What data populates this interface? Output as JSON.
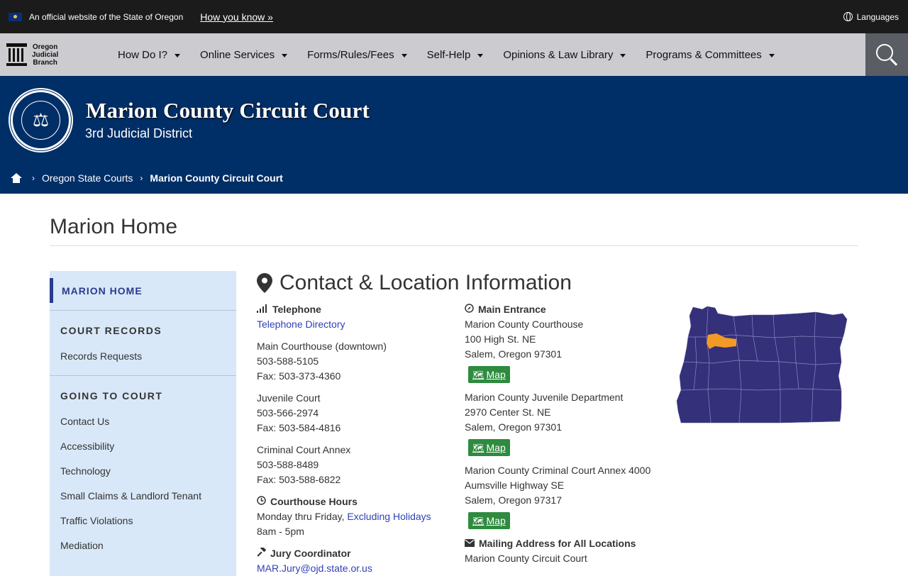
{
  "gov_banner": {
    "official_text": "An official website of the State of Oregon",
    "how_you_know": "How you know »",
    "languages": "Languages"
  },
  "brand": {
    "logo_lines": [
      "Oregon",
      "Judicial",
      "Branch"
    ]
  },
  "nav": {
    "items": [
      {
        "label": "How Do I?"
      },
      {
        "label": "Online Services"
      },
      {
        "label": "Forms/Rules/Fees"
      },
      {
        "label": "Self-Help"
      },
      {
        "label": "Opinions & Law Library"
      },
      {
        "label": "Programs & Committees"
      }
    ]
  },
  "header": {
    "title": "Marion County Circuit Court",
    "subtitle": "3rd Judicial District"
  },
  "breadcrumb": {
    "items": [
      "Oregon State Courts",
      "Marion County Circuit Court"
    ]
  },
  "page": {
    "title": "Marion Home"
  },
  "sidebar": {
    "home": "MARION HOME",
    "sections": [
      {
        "heading": "COURT RECORDS",
        "links": [
          "Records Requests"
        ]
      },
      {
        "heading": "GOING TO COURT",
        "links": [
          "Contact Us",
          "Accessibility",
          "Technology",
          "Small Claims & Landlord Tenant",
          "Traffic Violations",
          "Mediation"
        ]
      }
    ]
  },
  "contact": {
    "title": "Contact & Location Information",
    "telephone": {
      "label": "Telephone",
      "directory_link": "Telephone Directory",
      "groups": [
        {
          "name": "Main Courthouse (downtown)",
          "phone": "503-588-5105",
          "fax": "Fax: 503-373-4360"
        },
        {
          "name": "Juvenile Court",
          "phone": "503-566-2974",
          "fax": "Fax: 503-584-4816"
        },
        {
          "name": "Criminal Court Annex",
          "phone": "503-588-8489",
          "fax": "Fax: 503-588-6822"
        }
      ]
    },
    "hours": {
      "label": "Courthouse Hours",
      "days": "Monday thru Friday,",
      "holidays_link": "Excluding Holidays",
      "time": "8am - 5pm"
    },
    "jury": {
      "label": "Jury Coordinator",
      "email": "MAR.Jury@ojd.state.or.us"
    },
    "entrance": {
      "label": "Main Entrance",
      "locations": [
        {
          "lines": [
            "Marion County Courthouse",
            "100 High St. NE",
            "Salem, Oregon 97301"
          ]
        },
        {
          "lines": [
            "Marion County Juvenile Department",
            "2970 Center St. NE",
            "Salem, Oregon 97301"
          ]
        },
        {
          "lines": [
            "Marion County Criminal Court Annex 4000",
            "Aumsville Highway SE",
            "Salem, Oregon 97317"
          ]
        }
      ],
      "map_label": "Map"
    },
    "mailing": {
      "label": "Mailing Address for All Locations",
      "first_line": "Marion County Circuit Court"
    }
  },
  "colors": {
    "header_blue": "#002e66",
    "state_fill": "#34307a",
    "county_highlight": "#f39a26",
    "map_button": "#2e8b3f"
  }
}
